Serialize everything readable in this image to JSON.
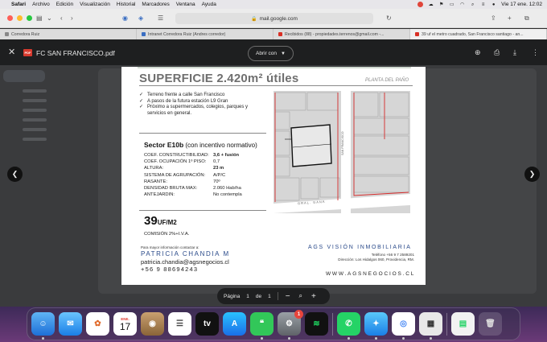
{
  "menubar": {
    "app": "Safari",
    "items": [
      "Archivo",
      "Edición",
      "Visualización",
      "Historial",
      "Marcadores",
      "Ventana",
      "Ayuda"
    ],
    "clock": "Vie 17 ene.  12:02"
  },
  "browser": {
    "address": "mail.google.com",
    "tabs": [
      {
        "label": "Corredora Ruiz",
        "color": "#888888"
      },
      {
        "label": "Intranet Corredora Ruiz (Andres corredor)",
        "color": "#3a6ec2"
      },
      {
        "label": "Recibidos (88) - propiedades.terrenos@gmail.com -...",
        "color": "#d93025"
      },
      {
        "label": "39 uf el metro cuadrado, San Francisco santiago - an...",
        "color": "#d93025"
      }
    ]
  },
  "viewer": {
    "filename": "FC SAN FRANCISCO.pdf",
    "file_badge": "PDF",
    "open_with": "Abrir con",
    "page_label": "Página",
    "page_current": "1",
    "page_of": "de",
    "page_total": "1"
  },
  "pdf": {
    "title": "SUPERFICIE 2.420m² útiles",
    "plan_label": "PLANTA DEL PAÑO",
    "bullets": [
      "Terreno frente a calle San Francisco",
      "A pasos de la futura estación L9 Gran",
      "Próximo a supermercados, colegios, parques y servicios en general."
    ],
    "sector_bold": "Sector E10b",
    "sector_rest": " (con incentivo normativo)",
    "specs": [
      {
        "k": "Coef. Constructibilidad:",
        "v": "3,6 + fusión",
        "bold": true
      },
      {
        "k": "Coef. Ocupación 1º piso:",
        "v": "0,7",
        "bold": false
      },
      {
        "k": "Altura:",
        "v": "23 m",
        "bold": true
      },
      {
        "k": "Sistema de agrupación:",
        "v": "A/P/C",
        "bold": false
      },
      {
        "k": "Rasante:",
        "v": "70º",
        "bold": false
      },
      {
        "k": "Densidad bruta max:",
        "v": "2.060 Hab/ha",
        "bold": false
      },
      {
        "k": "Antejardin:",
        "v": "No contempla",
        "bold": false
      }
    ],
    "price_num": "39",
    "price_unit": "UF/M2",
    "commission": "COMISIÓN 2%+I.V.A.",
    "contact_intro": "Para mayor información contactar a:",
    "contact_name": "PATRICIA CHANDIA M",
    "contact_email": "patricia.chandia@agsnegocios.cl",
    "contact_phone": "+56 9 88694243",
    "company": "AGS VISIÓN INMOBILIARIA",
    "company_phone": "Teléfono +56 9 7 2589201",
    "company_address": "Dirección: Los Hidalgos 060, Providencia, RM.",
    "company_web": "WWW.AGSNEGOCIOS.CL",
    "map_street_vertical": "SAN FRANCISCO",
    "map_street_horizontal": "GRAL. GANA"
  },
  "dock": {
    "calendar_month": "ENE.",
    "calendar_day": "17",
    "settings_badge": "1"
  }
}
